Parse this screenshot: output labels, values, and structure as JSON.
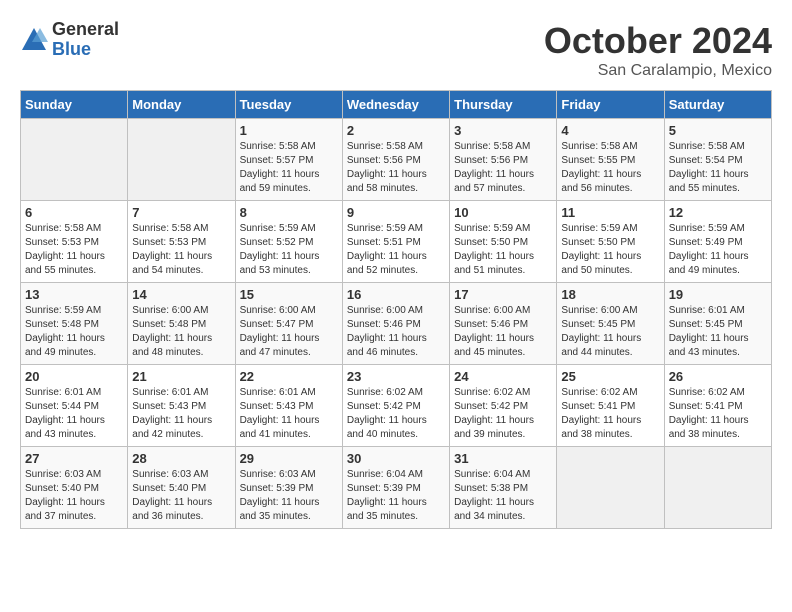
{
  "header": {
    "logo_general": "General",
    "logo_blue": "Blue",
    "month_title": "October 2024",
    "location": "San Caralampio, Mexico"
  },
  "days_of_week": [
    "Sunday",
    "Monday",
    "Tuesday",
    "Wednesday",
    "Thursday",
    "Friday",
    "Saturday"
  ],
  "weeks": [
    [
      {
        "day": "",
        "empty": true
      },
      {
        "day": "",
        "empty": true
      },
      {
        "day": "1",
        "sunrise": "Sunrise: 5:58 AM",
        "sunset": "Sunset: 5:57 PM",
        "daylight": "Daylight: 11 hours and 59 minutes."
      },
      {
        "day": "2",
        "sunrise": "Sunrise: 5:58 AM",
        "sunset": "Sunset: 5:56 PM",
        "daylight": "Daylight: 11 hours and 58 minutes."
      },
      {
        "day": "3",
        "sunrise": "Sunrise: 5:58 AM",
        "sunset": "Sunset: 5:56 PM",
        "daylight": "Daylight: 11 hours and 57 minutes."
      },
      {
        "day": "4",
        "sunrise": "Sunrise: 5:58 AM",
        "sunset": "Sunset: 5:55 PM",
        "daylight": "Daylight: 11 hours and 56 minutes."
      },
      {
        "day": "5",
        "sunrise": "Sunrise: 5:58 AM",
        "sunset": "Sunset: 5:54 PM",
        "daylight": "Daylight: 11 hours and 55 minutes."
      }
    ],
    [
      {
        "day": "6",
        "sunrise": "Sunrise: 5:58 AM",
        "sunset": "Sunset: 5:53 PM",
        "daylight": "Daylight: 11 hours and 55 minutes."
      },
      {
        "day": "7",
        "sunrise": "Sunrise: 5:58 AM",
        "sunset": "Sunset: 5:53 PM",
        "daylight": "Daylight: 11 hours and 54 minutes."
      },
      {
        "day": "8",
        "sunrise": "Sunrise: 5:59 AM",
        "sunset": "Sunset: 5:52 PM",
        "daylight": "Daylight: 11 hours and 53 minutes."
      },
      {
        "day": "9",
        "sunrise": "Sunrise: 5:59 AM",
        "sunset": "Sunset: 5:51 PM",
        "daylight": "Daylight: 11 hours and 52 minutes."
      },
      {
        "day": "10",
        "sunrise": "Sunrise: 5:59 AM",
        "sunset": "Sunset: 5:50 PM",
        "daylight": "Daylight: 11 hours and 51 minutes."
      },
      {
        "day": "11",
        "sunrise": "Sunrise: 5:59 AM",
        "sunset": "Sunset: 5:50 PM",
        "daylight": "Daylight: 11 hours and 50 minutes."
      },
      {
        "day": "12",
        "sunrise": "Sunrise: 5:59 AM",
        "sunset": "Sunset: 5:49 PM",
        "daylight": "Daylight: 11 hours and 49 minutes."
      }
    ],
    [
      {
        "day": "13",
        "sunrise": "Sunrise: 5:59 AM",
        "sunset": "Sunset: 5:48 PM",
        "daylight": "Daylight: 11 hours and 49 minutes."
      },
      {
        "day": "14",
        "sunrise": "Sunrise: 6:00 AM",
        "sunset": "Sunset: 5:48 PM",
        "daylight": "Daylight: 11 hours and 48 minutes."
      },
      {
        "day": "15",
        "sunrise": "Sunrise: 6:00 AM",
        "sunset": "Sunset: 5:47 PM",
        "daylight": "Daylight: 11 hours and 47 minutes."
      },
      {
        "day": "16",
        "sunrise": "Sunrise: 6:00 AM",
        "sunset": "Sunset: 5:46 PM",
        "daylight": "Daylight: 11 hours and 46 minutes."
      },
      {
        "day": "17",
        "sunrise": "Sunrise: 6:00 AM",
        "sunset": "Sunset: 5:46 PM",
        "daylight": "Daylight: 11 hours and 45 minutes."
      },
      {
        "day": "18",
        "sunrise": "Sunrise: 6:00 AM",
        "sunset": "Sunset: 5:45 PM",
        "daylight": "Daylight: 11 hours and 44 minutes."
      },
      {
        "day": "19",
        "sunrise": "Sunrise: 6:01 AM",
        "sunset": "Sunset: 5:45 PM",
        "daylight": "Daylight: 11 hours and 43 minutes."
      }
    ],
    [
      {
        "day": "20",
        "sunrise": "Sunrise: 6:01 AM",
        "sunset": "Sunset: 5:44 PM",
        "daylight": "Daylight: 11 hours and 43 minutes."
      },
      {
        "day": "21",
        "sunrise": "Sunrise: 6:01 AM",
        "sunset": "Sunset: 5:43 PM",
        "daylight": "Daylight: 11 hours and 42 minutes."
      },
      {
        "day": "22",
        "sunrise": "Sunrise: 6:01 AM",
        "sunset": "Sunset: 5:43 PM",
        "daylight": "Daylight: 11 hours and 41 minutes."
      },
      {
        "day": "23",
        "sunrise": "Sunrise: 6:02 AM",
        "sunset": "Sunset: 5:42 PM",
        "daylight": "Daylight: 11 hours and 40 minutes."
      },
      {
        "day": "24",
        "sunrise": "Sunrise: 6:02 AM",
        "sunset": "Sunset: 5:42 PM",
        "daylight": "Daylight: 11 hours and 39 minutes."
      },
      {
        "day": "25",
        "sunrise": "Sunrise: 6:02 AM",
        "sunset": "Sunset: 5:41 PM",
        "daylight": "Daylight: 11 hours and 38 minutes."
      },
      {
        "day": "26",
        "sunrise": "Sunrise: 6:02 AM",
        "sunset": "Sunset: 5:41 PM",
        "daylight": "Daylight: 11 hours and 38 minutes."
      }
    ],
    [
      {
        "day": "27",
        "sunrise": "Sunrise: 6:03 AM",
        "sunset": "Sunset: 5:40 PM",
        "daylight": "Daylight: 11 hours and 37 minutes."
      },
      {
        "day": "28",
        "sunrise": "Sunrise: 6:03 AM",
        "sunset": "Sunset: 5:40 PM",
        "daylight": "Daylight: 11 hours and 36 minutes."
      },
      {
        "day": "29",
        "sunrise": "Sunrise: 6:03 AM",
        "sunset": "Sunset: 5:39 PM",
        "daylight": "Daylight: 11 hours and 35 minutes."
      },
      {
        "day": "30",
        "sunrise": "Sunrise: 6:04 AM",
        "sunset": "Sunset: 5:39 PM",
        "daylight": "Daylight: 11 hours and 35 minutes."
      },
      {
        "day": "31",
        "sunrise": "Sunrise: 6:04 AM",
        "sunset": "Sunset: 5:38 PM",
        "daylight": "Daylight: 11 hours and 34 minutes."
      },
      {
        "day": "",
        "empty": true
      },
      {
        "day": "",
        "empty": true
      }
    ]
  ]
}
